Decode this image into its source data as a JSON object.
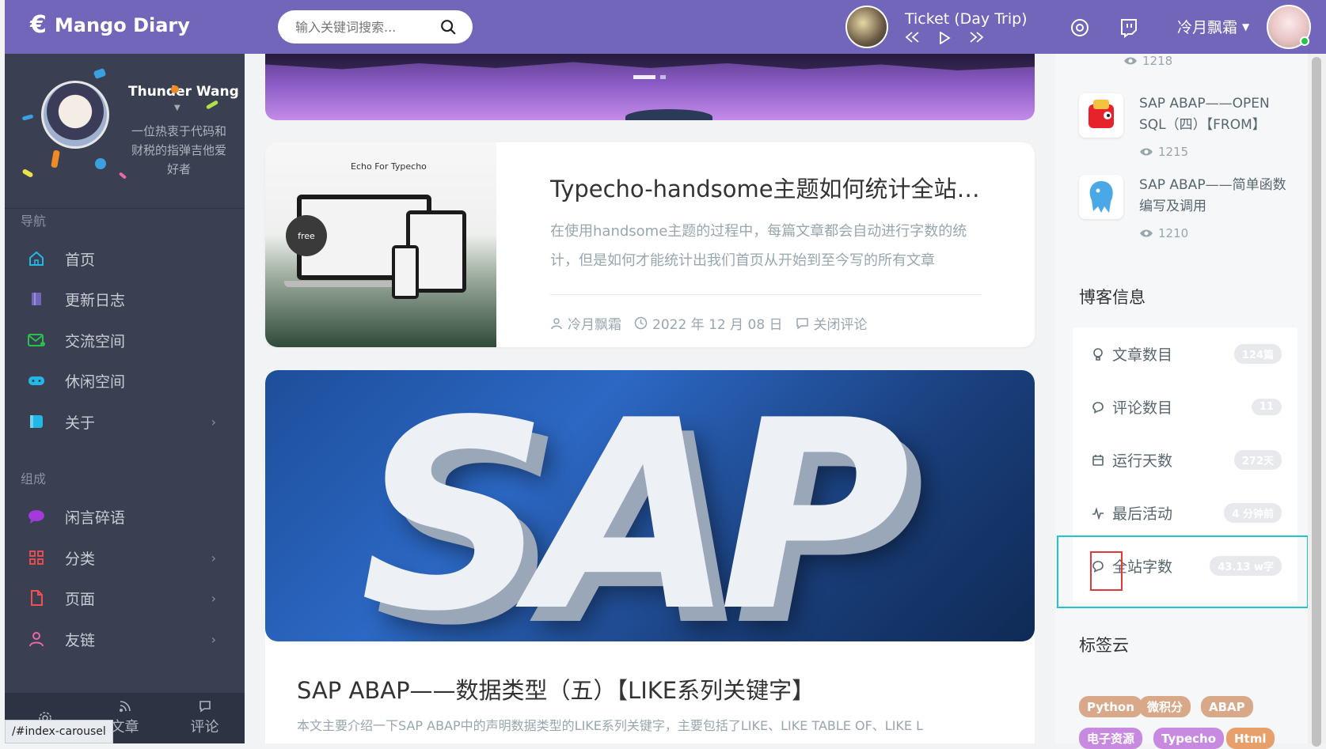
{
  "header": {
    "logo_symbol": "€",
    "logo_text": "Mango Diary",
    "search_placeholder": "输入关键词搜索...",
    "player": {
      "song": "Ticket (Day Trip)"
    },
    "user_name": "冷月飘霜",
    "accent_color": "#7266ba"
  },
  "sidebar": {
    "profile": {
      "name": "Thunder Wang",
      "bio": "一位热衷于代码和财税的指弹吉他爱好者"
    },
    "nav_heading": "导航",
    "nav_items": [
      {
        "label": "首页",
        "icon": "home-icon"
      },
      {
        "label": "更新日志",
        "icon": "book-icon"
      },
      {
        "label": "交流空间",
        "icon": "mail-icon"
      },
      {
        "label": "休闲空间",
        "icon": "gamepad-icon"
      },
      {
        "label": "关于",
        "icon": "note-icon"
      }
    ],
    "group_heading": "组成",
    "group_items": [
      {
        "label": "闲言碎语",
        "icon": "chat-icon"
      },
      {
        "label": "分类",
        "icon": "grid-icon"
      },
      {
        "label": "页面",
        "icon": "file-icon"
      },
      {
        "label": "友链",
        "icon": "person-icon"
      }
    ],
    "footer": [
      {
        "label": "文章",
        "icon": "rss-icon"
      },
      {
        "label": "评论",
        "icon": "comment-icon"
      }
    ],
    "status_url": "/#index-carousel"
  },
  "posts": [
    {
      "title": "Typecho-handsome主题如何统计全站字...",
      "thumb_caption": "Echo For Typecho",
      "thumb_badge": "free",
      "summary": "在使用handsome主题的过程中，每篇文章都会自动进行字数的统计，但是如何才能统计出我们首页从开始到至今写的所有文章",
      "author": "冷月飘霜",
      "date": "2022 年 12 月 08 日",
      "comments": "关闭评论"
    },
    {
      "image_text": "SAP",
      "title": "SAP ABAP——数据类型（五）【LIKE系列关键字】",
      "summary": "本文主要介绍一下SAP ABAP中的声明数据类型的LIKE系列关键字，主要包括了LIKE、LIKE TABLE OF、LIKE L"
    }
  ],
  "right_panel": {
    "top_views": "1218",
    "hot_posts": [
      {
        "title": "SAP ABAP——OPEN SQL（四）【FROM】",
        "views": "1215"
      },
      {
        "title": "SAP ABAP——简单函数编写及调用",
        "views": "1210"
      }
    ],
    "blog_info_title": "博客信息",
    "blog_info": [
      {
        "label": "文章数目",
        "value": "124篇",
        "icon": "bulb-icon"
      },
      {
        "label": "评论数目",
        "value": "11",
        "icon": "comment-icon"
      },
      {
        "label": "运行天数",
        "value": "272天",
        "icon": "calendar-icon"
      },
      {
        "label": "最后活动",
        "value": "4 分钟前",
        "icon": "pulse-icon"
      },
      {
        "label": "全站字数",
        "value": "43.13 w字",
        "icon": "comment-icon"
      }
    ],
    "tag_cloud_title": "标签云",
    "tags": [
      {
        "label": "Python",
        "color": "#d8a889"
      },
      {
        "label": "微积分",
        "color": "#d8a889"
      },
      {
        "label": "ABAP",
        "color": "#d8a889"
      },
      {
        "label": "电子资源",
        "color": "#c88ae0"
      },
      {
        "label": "Typecho",
        "color": "#c88ae0"
      },
      {
        "label": "Html",
        "color": "#e8a06a"
      }
    ]
  }
}
